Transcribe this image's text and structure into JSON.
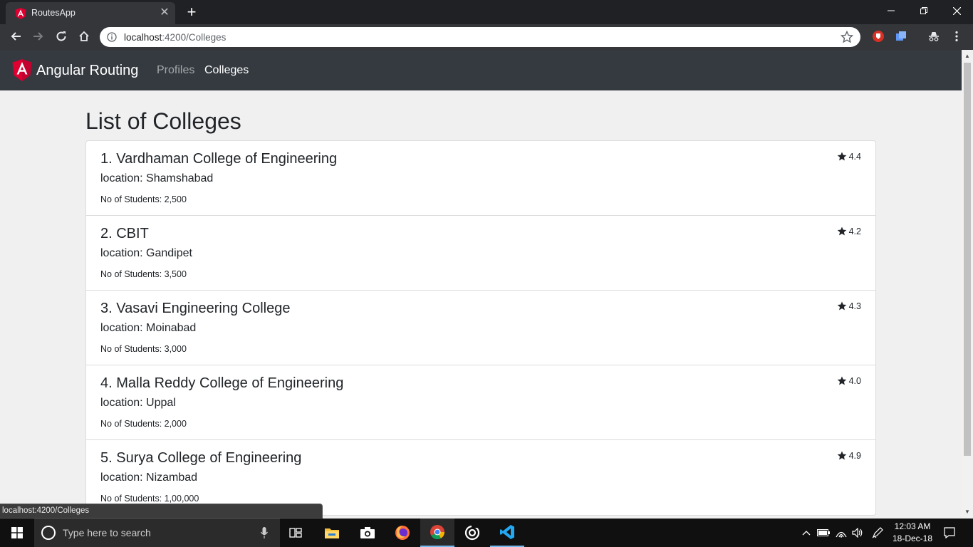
{
  "browser": {
    "tab_title": "RoutesApp",
    "tab_close": "✕",
    "new_tab": "+",
    "url_host": "localhost",
    "url_path": ":4200/Colleges",
    "status_url": "localhost:4200/Colleges"
  },
  "navbar": {
    "brand": "Angular Routing",
    "links": [
      {
        "label": "Profiles",
        "active": false
      },
      {
        "label": "Colleges",
        "active": true
      }
    ]
  },
  "page": {
    "heading": "List of Colleges",
    "colleges": [
      {
        "name": "1. Vardhaman College of Engineering",
        "location": "location: Shamshabad",
        "students": "No of Students: 2,500",
        "rating": "4.4"
      },
      {
        "name": "2. CBIT",
        "location": "location: Gandipet",
        "students": "No of Students: 3,500",
        "rating": "4.2"
      },
      {
        "name": "3. Vasavi Engineering College",
        "location": "location: Moinabad",
        "students": "No of Students: 3,000",
        "rating": "4.3"
      },
      {
        "name": "4. Malla Reddy College of Engineering",
        "location": "location: Uppal",
        "students": "No of Students: 2,000",
        "rating": "4.0"
      },
      {
        "name": "5. Surya College of Engineering",
        "location": "location: Nizambad",
        "students": "No of Students: 1,00,000",
        "rating": "4.9"
      }
    ]
  },
  "taskbar": {
    "search_placeholder": "Type here to search",
    "time": "12:03 AM",
    "date": "18-Dec-18"
  },
  "colors": {
    "navbar_bg": "#343a40",
    "angular_red": "#dd0031",
    "chrome_dark": "#202124"
  }
}
